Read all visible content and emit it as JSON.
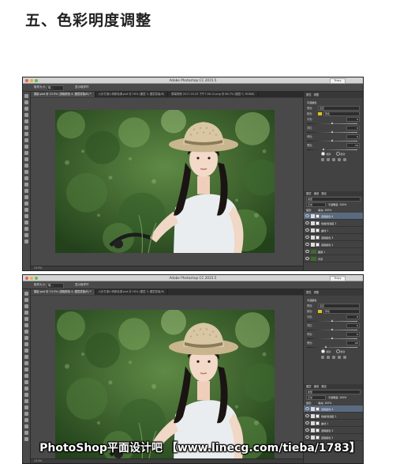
{
  "page": {
    "heading": "五、色彩明度调整",
    "watermark": "PhotoShop平面设计吧 【www.linecg.com/tieba/1783】"
  },
  "colors": {
    "yellow_swatch": "#e2c21a",
    "selected_layer": "#5a6a80",
    "window_bg": "#3a3a3a",
    "canvas_bg": "#494949"
  },
  "icons": [
    "apple-menu-icon",
    "eye-icon",
    "adjustment-icon",
    "mask-icon",
    "tool-icon",
    "hat-icon"
  ],
  "windows": [
    {
      "app_title": "Adobe Photoshop CC 2015.5",
      "workspace": "Tracy",
      "options": {
        "sample_size_label": "取样大小:",
        "sample_size_value": "取...",
        "show_ring": "显示取样环"
      },
      "tabs": [
        {
          "label": "摄影.psd @ 13.5% (选取颜色 4, 图层蒙版/8) *"
        },
        {
          "label": "六步打造小清新色调.psd @ 16% (图层 3, 图层蒙版/8)"
        },
        {
          "label": "屏幕快照 2017-03-25 下午7.06.12.png @ 66.7% (图层 0, RGB/8)"
        }
      ],
      "status": "13.5%",
      "panel_tabs": [
        "属性",
        "调整"
      ],
      "properties": {
        "title": "可选颜色",
        "preset_label": "预设:",
        "preset_value": "自定",
        "color_label": "颜色:",
        "color_value": "黄色",
        "sliders": [
          {
            "label": "青色:",
            "value": "0",
            "pct": 0.5
          },
          {
            "label": "洋红:",
            "value": "0",
            "pct": 0.5
          },
          {
            "label": "黄色:",
            "value": "0",
            "pct": 0.5
          },
          {
            "label": "黑色:",
            "value": "-34",
            "pct": 0.33
          }
        ],
        "mode_relative": "相对",
        "mode_absolute": "绝对"
      },
      "layers_tabs": [
        "图层",
        "通道",
        "路径"
      ],
      "kind_label": "类型",
      "blend_mode": "正常",
      "opacity_label": "不透明度: 100%",
      "lock_label": "锁定:",
      "fill_label": "填充: 100%",
      "layers": [
        {
          "name": "选取颜色 4",
          "type": "adj",
          "selected": true
        },
        {
          "name": "色相/饱和度 1",
          "type": "adj",
          "selected": false
        },
        {
          "name": "曲线 1",
          "type": "adj",
          "selected": false
        },
        {
          "name": "选取颜色 3",
          "type": "adj",
          "selected": false
        },
        {
          "name": "选取颜色 2",
          "type": "adj",
          "selected": false
        },
        {
          "name": "图层 1",
          "type": "img",
          "selected": false
        },
        {
          "name": "背景",
          "type": "img",
          "selected": false
        }
      ]
    },
    {
      "app_title": "Adobe Photoshop CC 2015.5",
      "workspace": "Tracy",
      "options": {
        "sample_size_label": "取样大小:",
        "sample_size_value": "取...",
        "show_ring": "显示取样环"
      },
      "tabs": [
        {
          "label": "摄影.psd @ 13.5% (选取颜色 4, 图层蒙版/8) *"
        },
        {
          "label": "六步打造小清新色调.psd @ 16% (图层 3, 图层蒙版/8)"
        }
      ],
      "status": "13.5%",
      "panel_tabs": [
        "属性",
        "调整"
      ],
      "properties": {
        "title": "可选颜色",
        "preset_label": "预设:",
        "preset_value": "自定",
        "color_label": "颜色:",
        "color_value": "黄色",
        "sliders": [
          {
            "label": "青色:",
            "value": "0",
            "pct": 0.5
          },
          {
            "label": "洋红:",
            "value": "0",
            "pct": 0.5
          },
          {
            "label": "黄色:",
            "value": "0",
            "pct": 0.5
          },
          {
            "label": "黑色:",
            "value": "-25",
            "pct": 0.38
          }
        ],
        "mode_relative": "相对",
        "mode_absolute": "绝对"
      },
      "layers_tabs": [
        "图层",
        "通道",
        "路径"
      ],
      "kind_label": "类型",
      "blend_mode": "正常",
      "opacity_label": "不透明度: 100%",
      "lock_label": "锁定:",
      "fill_label": "填充: 100%",
      "layers": [
        {
          "name": "选取颜色 4",
          "type": "adj",
          "selected": true
        },
        {
          "name": "色相/饱和度 1",
          "type": "adj",
          "selected": false
        },
        {
          "name": "曲线 1",
          "type": "adj",
          "selected": false
        },
        {
          "name": "选取颜色 3",
          "type": "adj",
          "selected": false
        },
        {
          "name": "选取颜色 2",
          "type": "adj",
          "selected": false
        }
      ]
    }
  ]
}
